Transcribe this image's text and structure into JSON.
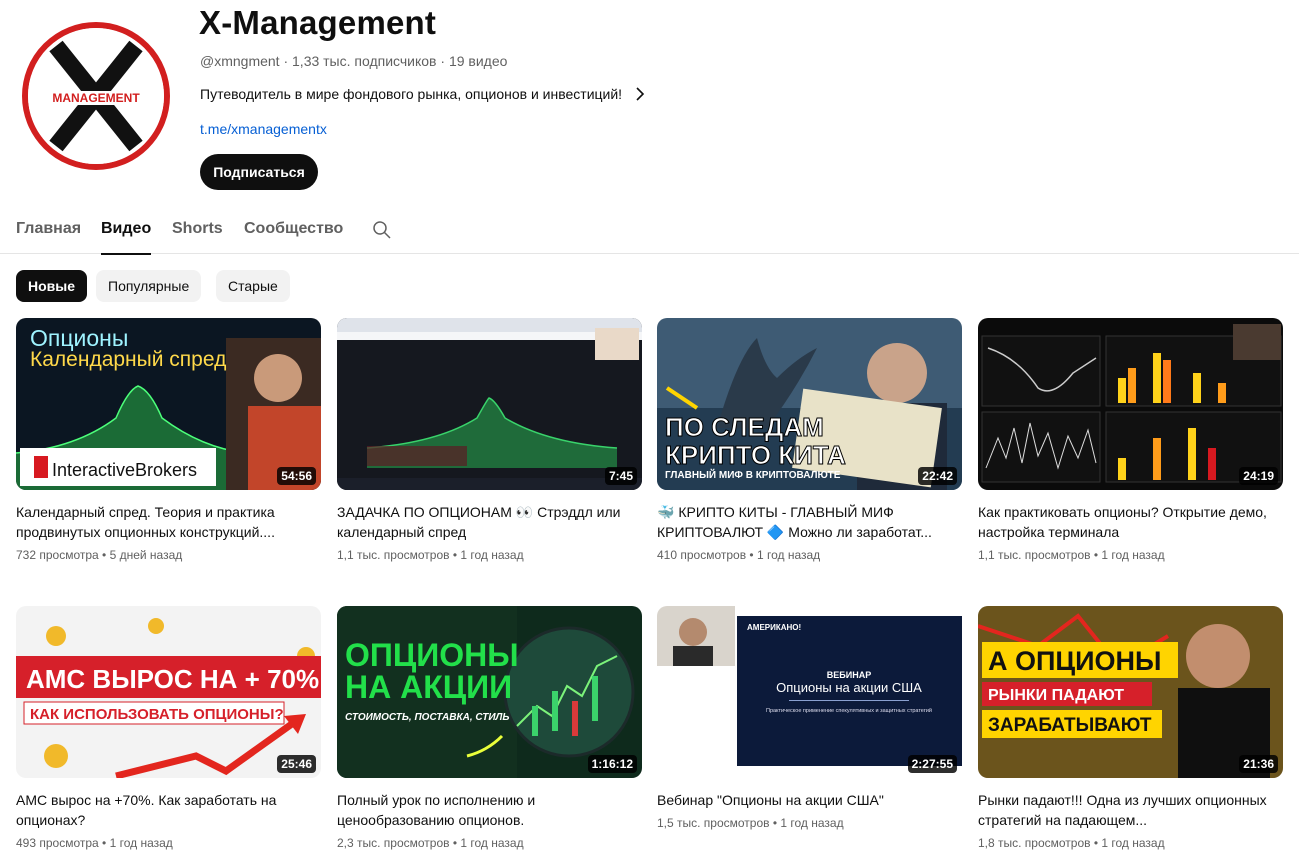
{
  "channel": {
    "title": "X-Management",
    "meta": "@xmngment · 1,33 тыс. подписчиков · 19 видео",
    "description": "Путеводитель в мире фондового рынка, опционов и инвестиций!",
    "link": "t.me/xmanagementx",
    "subscribe_label": "Подписаться",
    "avatar_text": "MANAGEMENT"
  },
  "tabs": [
    {
      "label": "Главная"
    },
    {
      "label": "Видео"
    },
    {
      "label": "Shorts"
    },
    {
      "label": "Сообщество"
    }
  ],
  "chips": [
    {
      "label": "Новые"
    },
    {
      "label": "Популярные"
    },
    {
      "label": "Старые"
    }
  ],
  "videos": [
    {
      "title": "Календарный спред. Теория и практика продвинутых опционных конструкций....",
      "meta": "732 просмотра • 5 дней назад",
      "duration": "54:56",
      "thumb_text": [
        "Опционы",
        "Календарный спред",
        "InteractiveBrokers"
      ]
    },
    {
      "title": "ЗАДАЧКА ПО ОПЦИОНАМ 👀 Стрэддл или календарный спред",
      "meta": "1,1 тыс. просмотров • 1 год назад",
      "duration": "7:45"
    },
    {
      "title": "🐳 КРИПТО КИТЫ - ГЛАВНЫЙ МИФ КРИПТОВАЛЮТ 🔷 Можно ли заработат...",
      "meta": "410 просмотров • 1 год назад",
      "duration": "22:42",
      "thumb_text": [
        "ПО СЛЕДАМ",
        "КРИПТО КИТА",
        "ГЛАВНЫЙ МИФ В КРИПТОВАЛЮТЕ"
      ]
    },
    {
      "title": "Как практиковать опционы? Открытие демо, настройка терминала",
      "meta": "1,1 тыс. просмотров • 1 год назад",
      "duration": "24:19"
    },
    {
      "title": "AMC вырос на +70%. Как заработать на опционах?",
      "meta": "493 просмотра • 1 год назад",
      "duration": "25:46",
      "thumb_text": [
        "AMC ВЫРОС НА + 70%",
        "КАК ИСПОЛЬЗОВАТЬ ОПЦИОНЫ?"
      ]
    },
    {
      "title": "Полный урок по исполнению и ценообразованию опционов.",
      "meta": "2,3 тыс. просмотров • 1 год назад",
      "duration": "1:16:12",
      "thumb_text": [
        "ОПЦИОНЫ",
        "НА АКЦИИ",
        "СТОИМОСТЬ, ПОСТАВКА, СТИЛЬ"
      ]
    },
    {
      "title": "Вебинар \"Опционы на акции США\"",
      "meta": "1,5 тыс. просмотров • 1 год назад",
      "duration": "2:27:55",
      "thumb_text": [
        "АМЕРИКАНО!",
        "ВЕБИНАР",
        "Опционы на акции США",
        "Практическое применение спекулятивных и защитных стратегий"
      ]
    },
    {
      "title": "Рынки падают!!! Одна из лучших опционных стратегий на падающем...",
      "meta": "1,8 тыс. просмотров • 1 год назад",
      "duration": "21:36",
      "thumb_text": [
        "А ОПЦИОНЫ",
        "РЫНКИ ПАДАЮТ",
        "ЗАРАБАТЫВАЮТ"
      ]
    }
  ]
}
